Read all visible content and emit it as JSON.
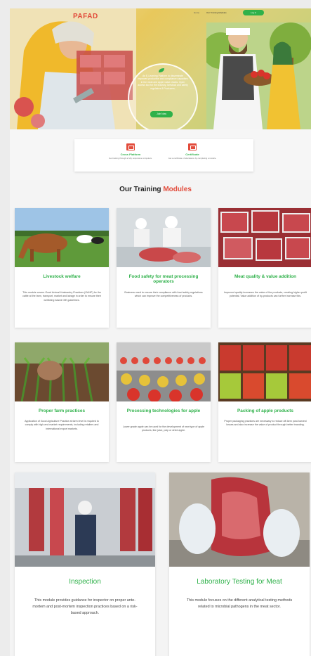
{
  "hero": {
    "logo_main": "PAFA",
    "logo_tail": "D",
    "nav_link_1": "Home",
    "nav_link_2": "Our Training Modules",
    "login_label": "Log in",
    "tagline": "An E-Learning Platform to disseminate improved productive and compliance capacities in the meat and apple value chains. Open access tool for the industry, livestock and safety regulators & Producers.",
    "join_label": "Join Now"
  },
  "features": [
    {
      "title": "Cross Platform",
      "desc": "Get training through a fully responsive computers."
    },
    {
      "title": "Certificate",
      "desc": "Get a certificate of attendance by completing a module."
    }
  ],
  "modules": {
    "title_prefix": "Our Training ",
    "title_highlight": "Modules",
    "cards": [
      {
        "title": "Livestock welfare",
        "desc": "This module covers Good Animal Husbandry Practices (GAHP) for the cattle at the farm, transport, market and lairage in order to ensure their wellbeing based OIE guidelines."
      },
      {
        "title": "Food safety for meat processing operators",
        "desc": "Business need to ensure their compliance with food safety regulations which can improve the competitiveness of products."
      },
      {
        "title": "Meat quality & value addition",
        "desc": "Improved quality increases the value of the products, creating higher profit potential. Value addition of by-products can further increase this."
      },
      {
        "title": "Proper farm practices",
        "desc": "Application of Good Agriculture Practice at farm level is required to comply with high-end market requirements, including retailers and international export markets."
      },
      {
        "title": "Processing technologies for apple",
        "desc": "Lower grade apple can be used for the development of new type of apple products, like juice, pulp or dried apple."
      },
      {
        "title": "Packing of apple products",
        "desc": "Proper packaging practices are necessary to reduce off-farm post-harvest losses and also increase the value of product through better branding."
      }
    ],
    "big_cards": [
      {
        "title": "Inspection",
        "desc": "This module provides guidance for inspector on proper ante-mortem and post-mortem inspection practices based on a risk-based approach."
      },
      {
        "title": "Laboratory Testing for Meat",
        "desc": "This module focuses on the different analytical testing methods related to microbial pathogens in the meat sector."
      }
    ]
  },
  "colors": {
    "accent_green": "#2fb14a",
    "accent_red": "#e24b3b"
  }
}
